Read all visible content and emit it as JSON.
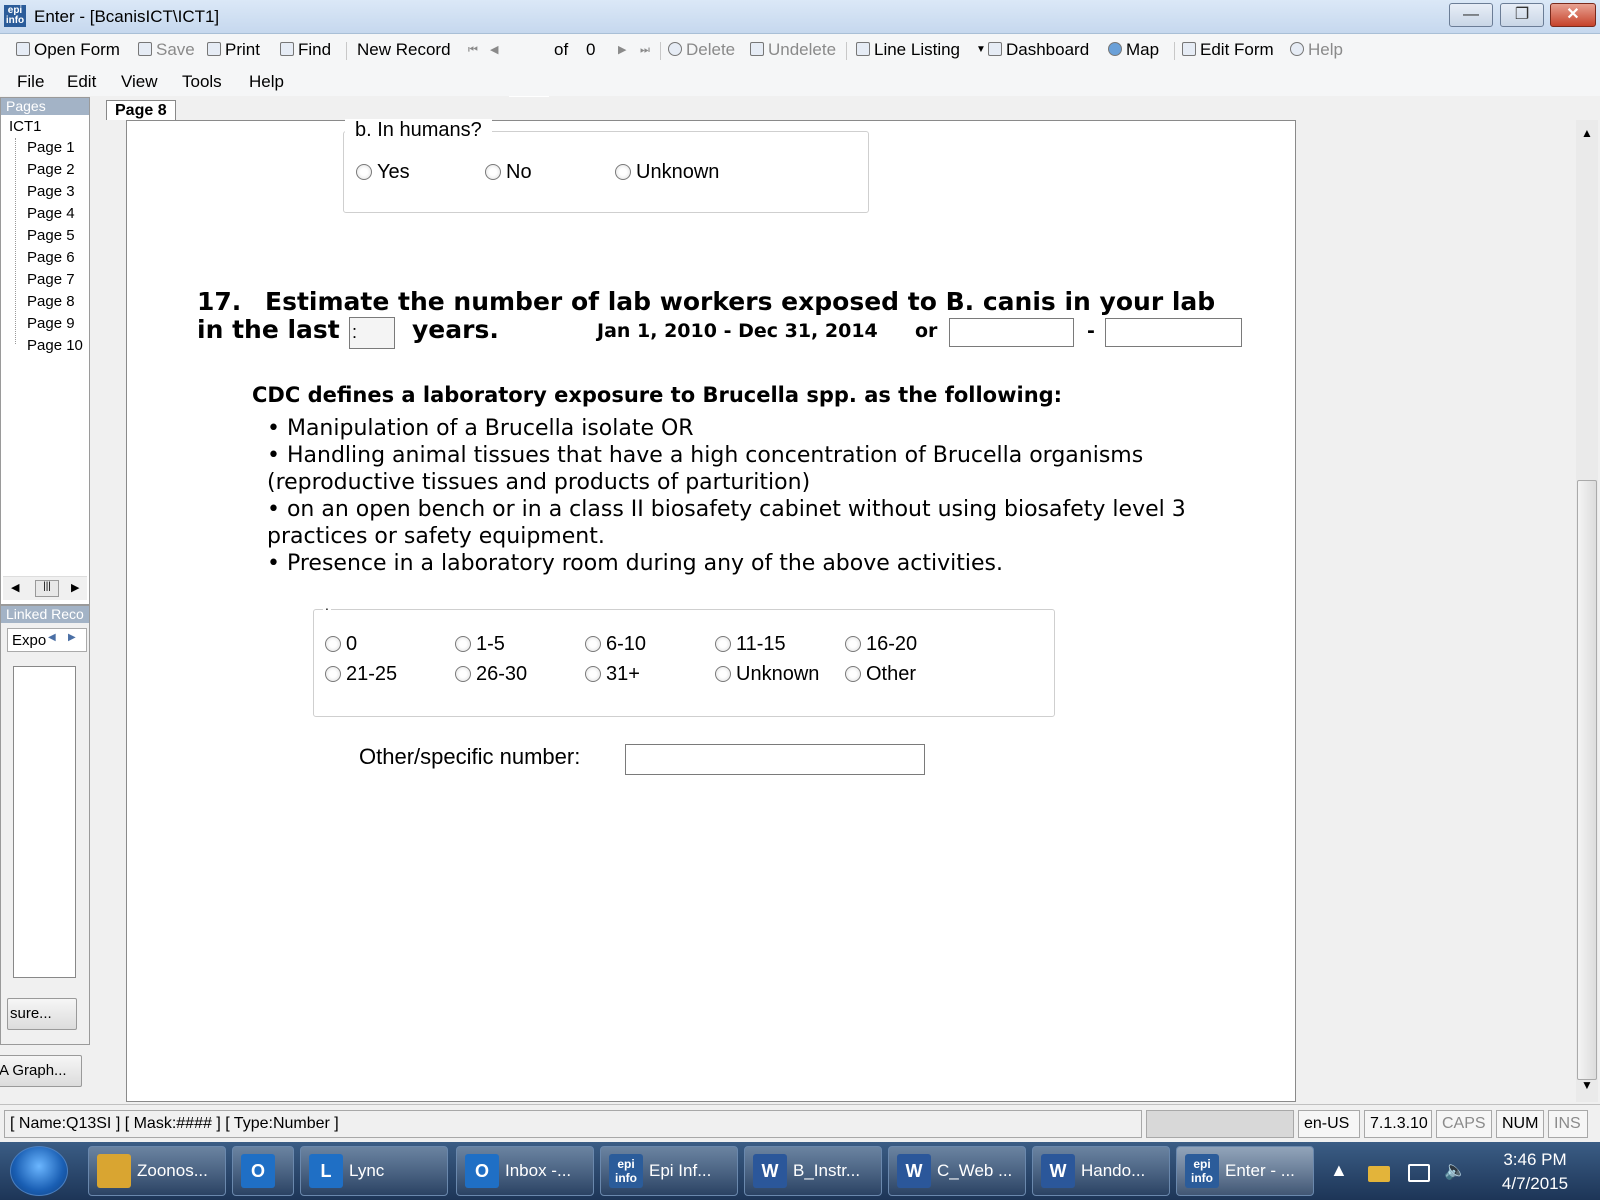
{
  "window": {
    "title": "Enter - [BcanisICT\\ICT1]",
    "app_icon": "epi info"
  },
  "toolbar": {
    "open_form": "Open Form",
    "save": "Save",
    "print": "Print",
    "find": "Find",
    "new_record": "New Record",
    "record_current": "*",
    "record_of": "of",
    "record_total": "0",
    "delete": "Delete",
    "undelete": "Undelete",
    "line_listing": "Line Listing",
    "dashboard": "Dashboard",
    "map": "Map",
    "edit_form": "Edit Form",
    "help": "Help"
  },
  "menubar": [
    "File",
    "Edit",
    "View",
    "Tools",
    "Help"
  ],
  "pages_panel": {
    "header": "Pages",
    "root": "ICT1",
    "items": [
      "Page 1",
      "Page 2",
      "Page 3",
      "Page 4",
      "Page 5",
      "Page 6",
      "Page 7",
      "Page 8",
      "Page 9",
      "Page 10"
    ]
  },
  "linked_panel": {
    "header": "Linked Reco",
    "tab": "Expo",
    "button1": "sure...",
    "button2": "A Graph..."
  },
  "page_tab": "Page 8",
  "q16b": {
    "legend": "b. In humans?",
    "options": [
      "Yes",
      "No",
      "Unknown"
    ]
  },
  "q17": {
    "number": "17.",
    "line1": "Estimate the number of lab workers exposed to B. canis in your lab",
    "line2_a": "in the last",
    "years_value": ":",
    "line2_b": "years.",
    "date_range": "Jan 1, 2010 - Dec 31, 2014",
    "or": "or",
    "dash": "-"
  },
  "cdc": {
    "title": "CDC defines a laboratory exposure to Brucella spp. as the following:",
    "lines": [
      "• Manipulation of a Brucella isolate OR",
      "• Handling animal tissues that have a high concentration of Brucella organisms",
      "(reproductive tissues and products of parturition)",
      "• on an open bench or in a class II biosafety cabinet without using biosafety level 3",
      "practices or safety equipment.",
      "• Presence in a laboratory room during any of the above activities."
    ]
  },
  "exposure_options": {
    "legend": ".",
    "row1": [
      "0",
      "1-5",
      "6-10",
      "11-15",
      "16-20"
    ],
    "row2": [
      "21-25",
      "26-30",
      "31+",
      "Unknown",
      "Other"
    ]
  },
  "other_number": {
    "label": "Other/specific number:",
    "value": ""
  },
  "statusbar": {
    "field_info": "[ Name:Q13SI ] [ Mask:#### ] [ Type:Number ]",
    "locale": "en-US",
    "version": "7.1.3.10",
    "caps": "CAPS",
    "num": "NUM",
    "ins": "INS"
  },
  "taskbar": {
    "items": [
      {
        "label": "Zoonos...",
        "icon": "folder-icon",
        "color": "#d9a531"
      },
      {
        "label": "",
        "icon": "outlook-icon",
        "color": "#1f6fc5"
      },
      {
        "label": "Lync",
        "icon": "lync-icon",
        "color": "#1f6fc5"
      },
      {
        "label": "Inbox -...",
        "icon": "outlook-icon",
        "color": "#1f6fc5"
      },
      {
        "label": "Epi Inf...",
        "icon": "epi-info-icon",
        "color": "#2b5c9a"
      },
      {
        "label": "B_Instr...",
        "icon": "word-icon",
        "color": "#2b579a"
      },
      {
        "label": "C_Web ...",
        "icon": "word-icon",
        "color": "#2b579a"
      },
      {
        "label": "Hando...",
        "icon": "word-icon",
        "color": "#2b579a"
      },
      {
        "label": "Enter - ...",
        "icon": "epi-info-icon",
        "color": "#2b5c9a"
      }
    ],
    "time": "3:46 PM",
    "date": "4/7/2015"
  }
}
